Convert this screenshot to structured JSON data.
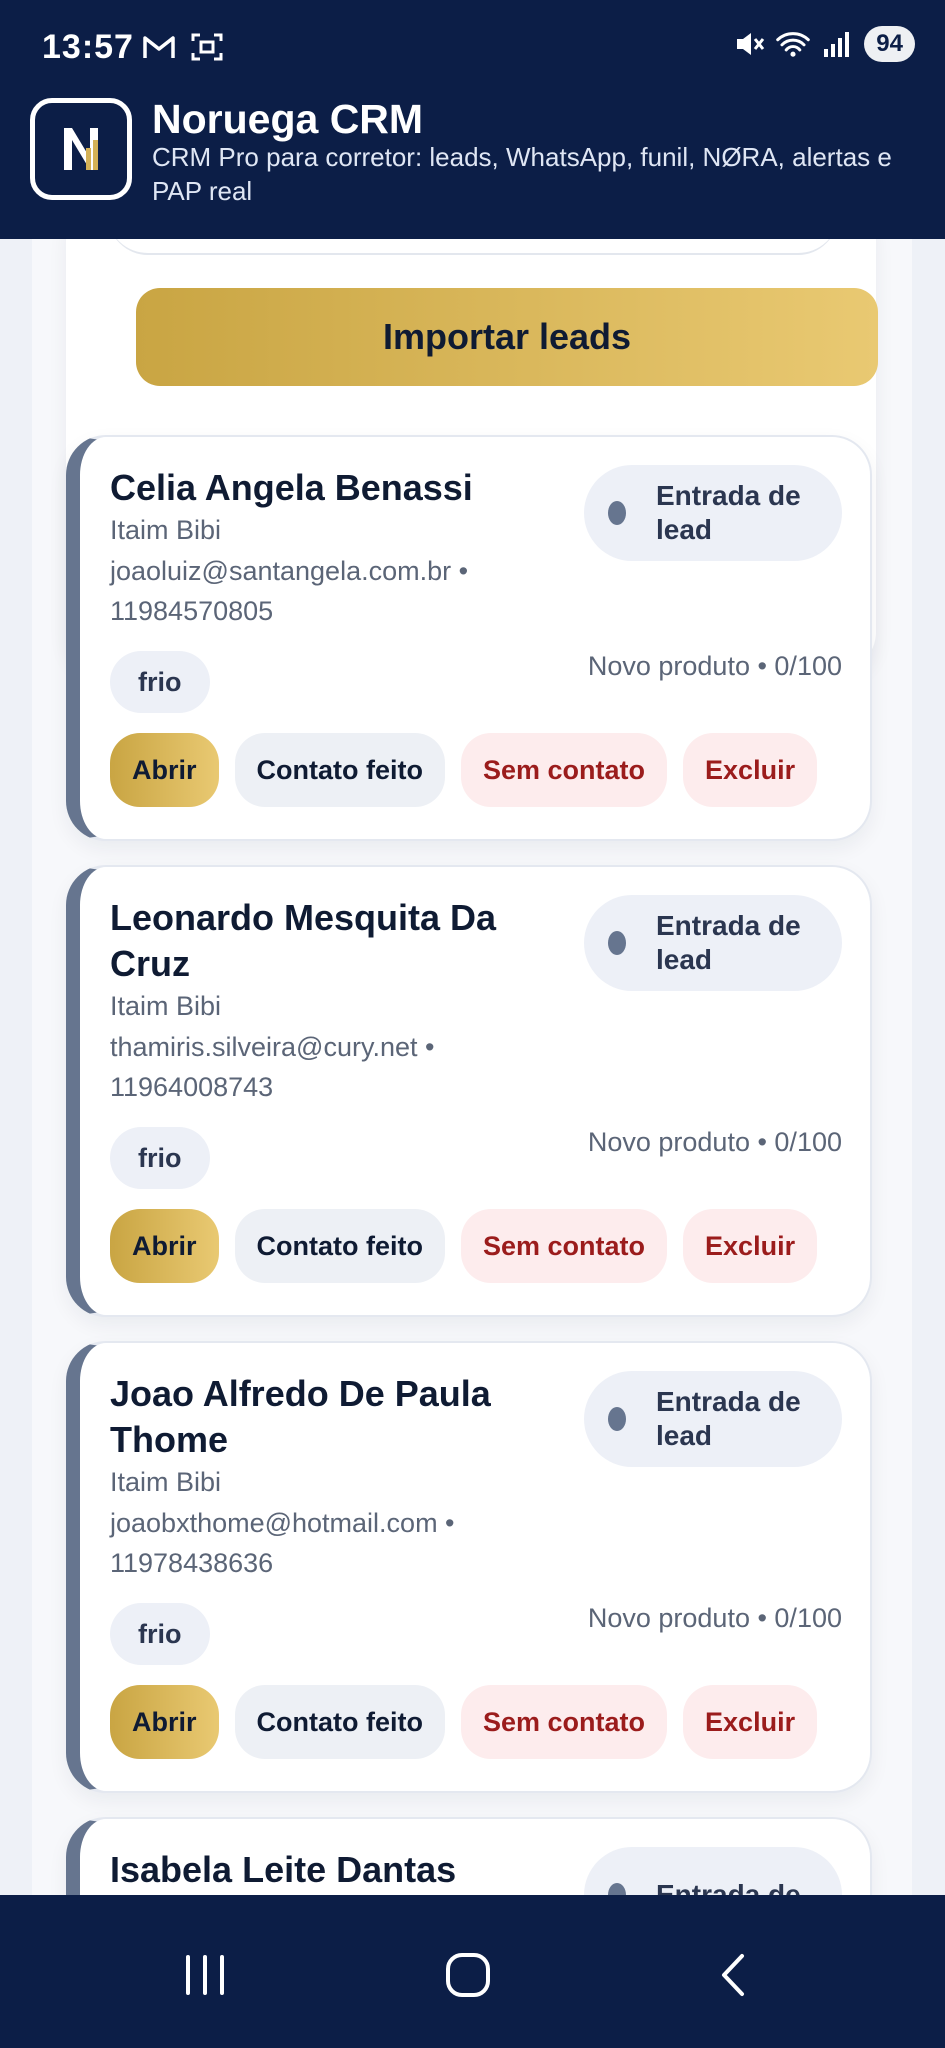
{
  "status_bar": {
    "time": "13:57",
    "battery": "94",
    "icons": [
      "gmail-icon",
      "screenshot-icon",
      "mute-icon",
      "wifi-icon",
      "signal-icon"
    ]
  },
  "app_bar": {
    "title": "Noruega CRM",
    "subtitle": "CRM Pro para corretor: leads, WhatsApp, funil, NØRA, alertas e PAP real"
  },
  "import": {
    "label": "Importar leads"
  },
  "leads": [
    {
      "name": "Celia Angela Benassi",
      "region": "Itaim Bibi",
      "contact": "joaoluiz@santangela.com.br • 11984570805",
      "stage": "Entrada de lead",
      "temperature": "frio",
      "product": "Novo produto • 0/100"
    },
    {
      "name": "Leonardo Mesquita Da Cruz",
      "region": "Itaim Bibi",
      "contact": "thamiris.silveira@cury.net • 11964008743",
      "stage": "Entrada de lead",
      "temperature": "frio",
      "product": "Novo produto • 0/100"
    },
    {
      "name": "Joao Alfredo De Paula Thome",
      "region": "Itaim Bibi",
      "contact": "joaobxthome@hotmail.com • 11978438636",
      "stage": "Entrada de lead",
      "temperature": "frio",
      "product": "Novo produto • 0/100"
    },
    {
      "name": "Isabela Leite Dantas",
      "stage": "Entrada de"
    }
  ],
  "actions": {
    "open": "Abrir",
    "contacted": "Contato feito",
    "no_contact": "Sem contato",
    "delete": "Excluir"
  },
  "colors": {
    "navy": "#0c1e47",
    "gold": "#d4b156",
    "danger": "#9b1c1c",
    "accent_bar": "#66758f"
  }
}
